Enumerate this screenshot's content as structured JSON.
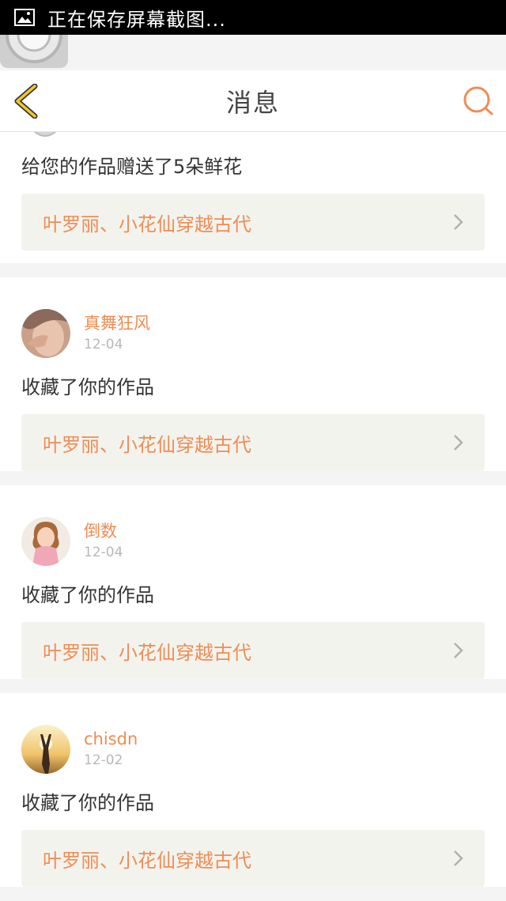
{
  "status_bar": {
    "text": "正在保存屏幕截图..."
  },
  "header": {
    "title": "消息"
  },
  "colors": {
    "accent": "#ef8d54",
    "back_icon": "#f1c72c"
  },
  "notifications": [
    {
      "action": "给您的作品赠送了5朵鲜花",
      "work": "叶罗丽、小花仙穿越古代"
    },
    {
      "name": "真舞狂风",
      "date": "12-04",
      "action": "收藏了你的作品",
      "work": "叶罗丽、小花仙穿越古代"
    },
    {
      "name": "倒数",
      "date": "12-04",
      "action": "收藏了你的作品",
      "work": "叶罗丽、小花仙穿越古代"
    },
    {
      "name": "chisdn",
      "date": "12-02",
      "action": "收藏了你的作品",
      "work": "叶罗丽、小花仙穿越古代"
    }
  ]
}
